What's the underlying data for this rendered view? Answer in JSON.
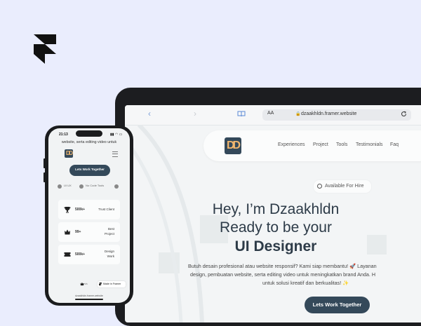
{
  "brand": {
    "icon": "framer-logo"
  },
  "browser": {
    "aa": "AA",
    "url": "dzaakhldn.framer.website"
  },
  "site": {
    "logo_text": "DD",
    "nav": [
      "Experiences",
      "Project",
      "Tools",
      "Testimonials",
      "Faq"
    ],
    "available": "Available For Hire",
    "hero_line1": "Hey, I’m Dzaakhldn",
    "hero_line2": "Ready to be your",
    "hero_line3": "UI Designer",
    "desc_line1": "Butuh desain profesional atau website responsif? Kami siap membantu! 🚀 Layanan",
    "desc_line2": "design, pembuatan website, serta editing video untuk meningkatkan brand Anda. H",
    "desc_line3": "untuk solusi kreatif dan berkualitas! ✨",
    "cta": "Lets Work Together"
  },
  "phone": {
    "time": "21:13",
    "signal": "▮▮ ◠ ▭",
    "header_text": "website, serta editing video untuk",
    "logo_text": "DD",
    "cta": "Lets Work Together",
    "chips": [
      "UI UX",
      "No Code Tools"
    ],
    "stats": [
      {
        "value": "500k+",
        "label1": "Trust Client",
        "label2": "",
        "icon": "trophy-icon"
      },
      {
        "value": "99+",
        "label1": "Best",
        "label2": "Project",
        "icon": "crown-icon"
      },
      {
        "value": "500k+",
        "label1": "Design",
        "label2": "Work",
        "icon": "ticket-icon"
      }
    ],
    "bottom_left": "Servis",
    "badge": "Made in Framer",
    "url": "dzaakhldn.framer.website"
  }
}
